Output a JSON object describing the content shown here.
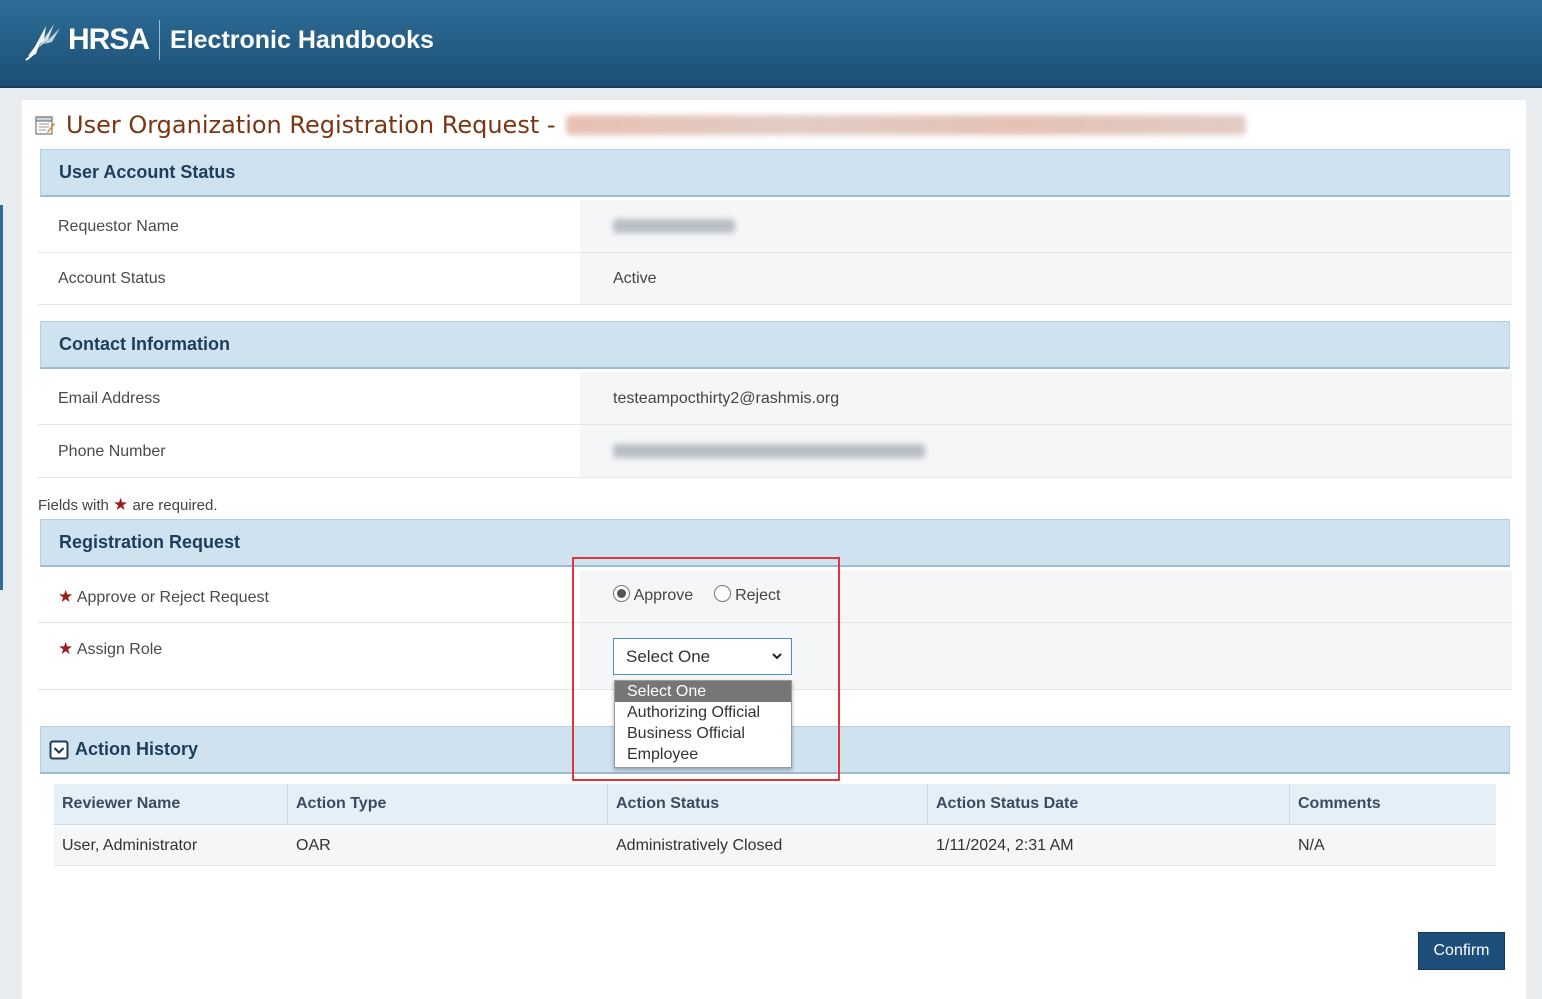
{
  "header": {
    "logo_text": "HRSA",
    "app_title": "Electronic Handbooks"
  },
  "page": {
    "title": "User Organization Registration Request -"
  },
  "user_account_status": {
    "heading": "User Account Status",
    "requestor_name_label": "Requestor Name",
    "account_status_label": "Account Status",
    "account_status_value": "Active"
  },
  "contact_information": {
    "heading": "Contact Information",
    "email_label": "Email Address",
    "email_value": "testeampocthirty2@rashmis.org",
    "phone_label": "Phone Number"
  },
  "required_note": {
    "prefix": "Fields with",
    "suffix": "are required."
  },
  "registration_request": {
    "heading": "Registration Request",
    "approve_reject_label": "Approve or Reject Request",
    "approve_label": "Approve",
    "reject_label": "Reject",
    "selected_decision": "Approve",
    "assign_role_label": "Assign Role",
    "role_selected": "Select One",
    "role_options": [
      "Select One",
      "Authorizing Official",
      "Business Official",
      "Employee"
    ]
  },
  "action_history": {
    "heading": "Action History",
    "columns": [
      "Reviewer Name",
      "Action Type",
      "Action Status",
      "Action Status Date",
      "Comments"
    ],
    "rows": [
      [
        "User, Administrator",
        "OAR",
        "Administratively Closed",
        "1/11/2024, 2:31 AM",
        "N/A"
      ]
    ]
  },
  "buttons": {
    "confirm": "Confirm"
  },
  "colors": {
    "header_bg": "#1c4f74",
    "title_text": "#7a3612",
    "section_bg": "#cfe2f0",
    "required_star": "#9c1c1c",
    "highlight": "#e0363b",
    "confirm_bg": "#1d4f7a"
  }
}
